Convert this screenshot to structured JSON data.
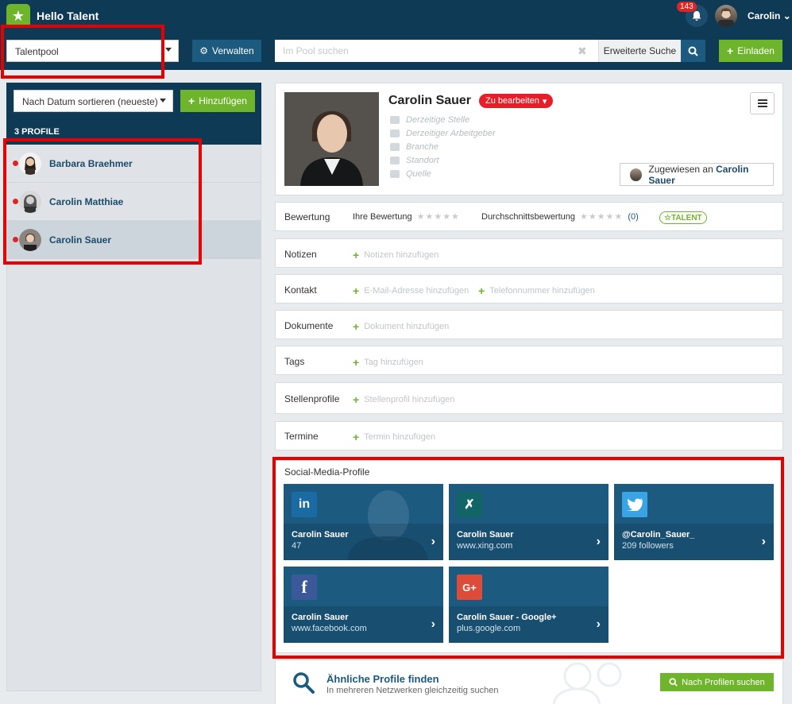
{
  "app": {
    "title": "Hello Talent"
  },
  "header": {
    "notification_count": "143",
    "user_name": "Carolin"
  },
  "toolbar": {
    "pool_select": "Talentpool",
    "manage_label": "Verwalten",
    "search_placeholder": "Im Pool suchen",
    "advanced_search_label": "Erweiterte Suche",
    "invite_label": "Einladen"
  },
  "sidebar": {
    "sort_select": "Nach Datum sortieren (neueste)",
    "add_label": "Hinzufügen",
    "count_label": "3 PROFILE",
    "profiles": [
      {
        "name": "Barbara Braehmer"
      },
      {
        "name": "Carolin Matthiae"
      },
      {
        "name": "Carolin Sauer"
      }
    ]
  },
  "profile": {
    "name": "Carolin Sauer",
    "status": "Zu bearbeiten",
    "meta": [
      "Derzeitige Stelle",
      "Derzeitiger Arbeitgeber",
      "Branche",
      "Standort",
      "Quelle"
    ],
    "assigned_prefix": "Zugewiesen an",
    "assigned_to": "Carolin Sauer"
  },
  "rating": {
    "label": "Bewertung",
    "own_label": "Ihre Bewertung",
    "avg_label": "Durchschnittsbewertung",
    "avg_count": "(0)",
    "talent_badge": "TALENT"
  },
  "sections": [
    {
      "label": "Notizen",
      "actions": [
        "Notizen hinzufügen"
      ]
    },
    {
      "label": "Kontakt",
      "actions": [
        "E-Mail-Adresse hinzufügen",
        "Telefonnummer hinzufügen"
      ]
    },
    {
      "label": "Dokumente",
      "actions": [
        "Dokument hinzufügen"
      ]
    },
    {
      "label": "Tags",
      "actions": [
        "Tag hinzufügen"
      ]
    },
    {
      "label": "Stellenprofile",
      "actions": [
        "Stellenprofil hinzufügen"
      ]
    },
    {
      "label": "Termine",
      "actions": [
        "Termin hinzufügen"
      ]
    }
  ],
  "social": {
    "title": "Social-Media-Profile",
    "tiles": [
      {
        "network": "linkedin",
        "logo": "in",
        "line1": "Carolin Sauer",
        "line2": "47",
        "color": "#1a6aa3"
      },
      {
        "network": "xing",
        "logo": "X",
        "line1": "Carolin Sauer",
        "line2": "www.xing.com",
        "color": "#126567"
      },
      {
        "network": "twitter",
        "logo": "t",
        "line1": "@Carolin_Sauer_",
        "line2": "209 followers",
        "color": "#3aa3e6"
      },
      {
        "network": "facebook",
        "logo": "f",
        "line1": "Carolin Sauer",
        "line2": "www.facebook.com",
        "color": "#3b5998"
      },
      {
        "network": "google-plus",
        "logo": "G+",
        "line1": "Carolin Sauer - Google+",
        "line2": "plus.google.com",
        "color": "#dd4b39"
      }
    ]
  },
  "similar": {
    "title": "Ähnliche Profile finden",
    "subtitle": "In mehreren Netzwerken gleichzeitig suchen",
    "button_label": "Nach Profilen suchen"
  },
  "colors": {
    "navy": "#0f3a55",
    "accent_blue": "#1c5a80",
    "green": "#6fb52c",
    "red": "#e61e2a"
  }
}
